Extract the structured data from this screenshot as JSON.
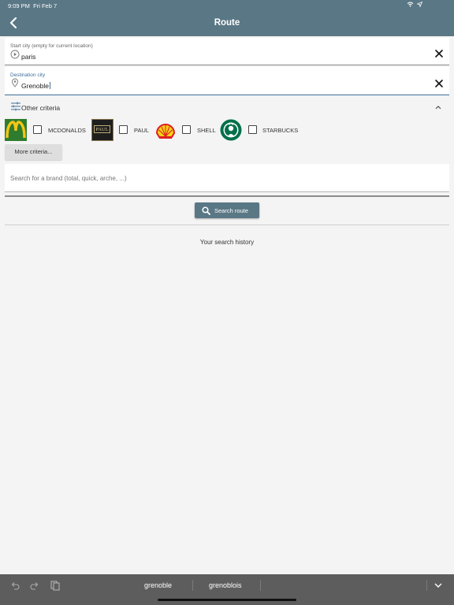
{
  "status_bar": {
    "time": "9:09 PM",
    "date": "Fri Feb 7",
    "icons": [
      "wifi-icon",
      "location-arrow-icon"
    ]
  },
  "header": {
    "title": "Route",
    "back_icon": "chevron-left-icon"
  },
  "start_field": {
    "label": "Start city (empty for current location)",
    "value": "paris",
    "icon": "play-circle-icon"
  },
  "destination_field": {
    "label": "Destination city",
    "value": "Grenoble",
    "icon": "map-pin-icon"
  },
  "criteria": {
    "label": "Other criteria",
    "brands": [
      {
        "name": "MCDONALDS",
        "logo": "mcdonalds-logo",
        "checked": false
      },
      {
        "name": "PAUL",
        "logo": "paul-logo",
        "logo_text": "PAUL",
        "checked": false
      },
      {
        "name": "SHELL",
        "logo": "shell-logo",
        "checked": false
      },
      {
        "name": "STARBUCKS",
        "logo": "starbucks-logo",
        "checked": false
      }
    ],
    "more_button": "More criteria..."
  },
  "brand_search": {
    "placeholder": "Search for a brand (total, quick, arche, ...)"
  },
  "search_route_button": "Search route",
  "history": {
    "title": "Your search history"
  },
  "keyboard_bar": {
    "suggestions": [
      "grenoble",
      "grenoblois"
    ]
  },
  "colors": {
    "app_bar": "#5a7785",
    "accent": "#3f6f9a",
    "keyboard_bar": "#5d5d5d"
  }
}
